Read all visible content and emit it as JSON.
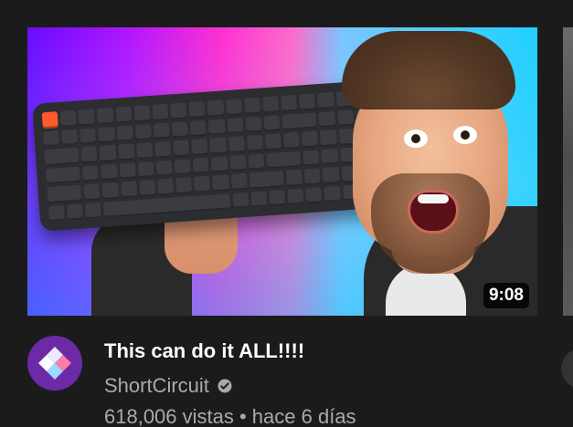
{
  "video": {
    "duration": "9:08",
    "title": "This can do it ALL!!!!",
    "channel": "ShortCircuit",
    "stats": "618,006 vistas • hace 6 días",
    "verified_icon": "verified-check-icon"
  },
  "avatar": {
    "icon": "shortcircuit-logo-icon",
    "bg_color": "#6c2aa6"
  },
  "colors": {
    "background": "#1b1b1b",
    "title": "#ffffff",
    "secondary_text": "#aaaaaa",
    "duration_bg": "#000000"
  }
}
